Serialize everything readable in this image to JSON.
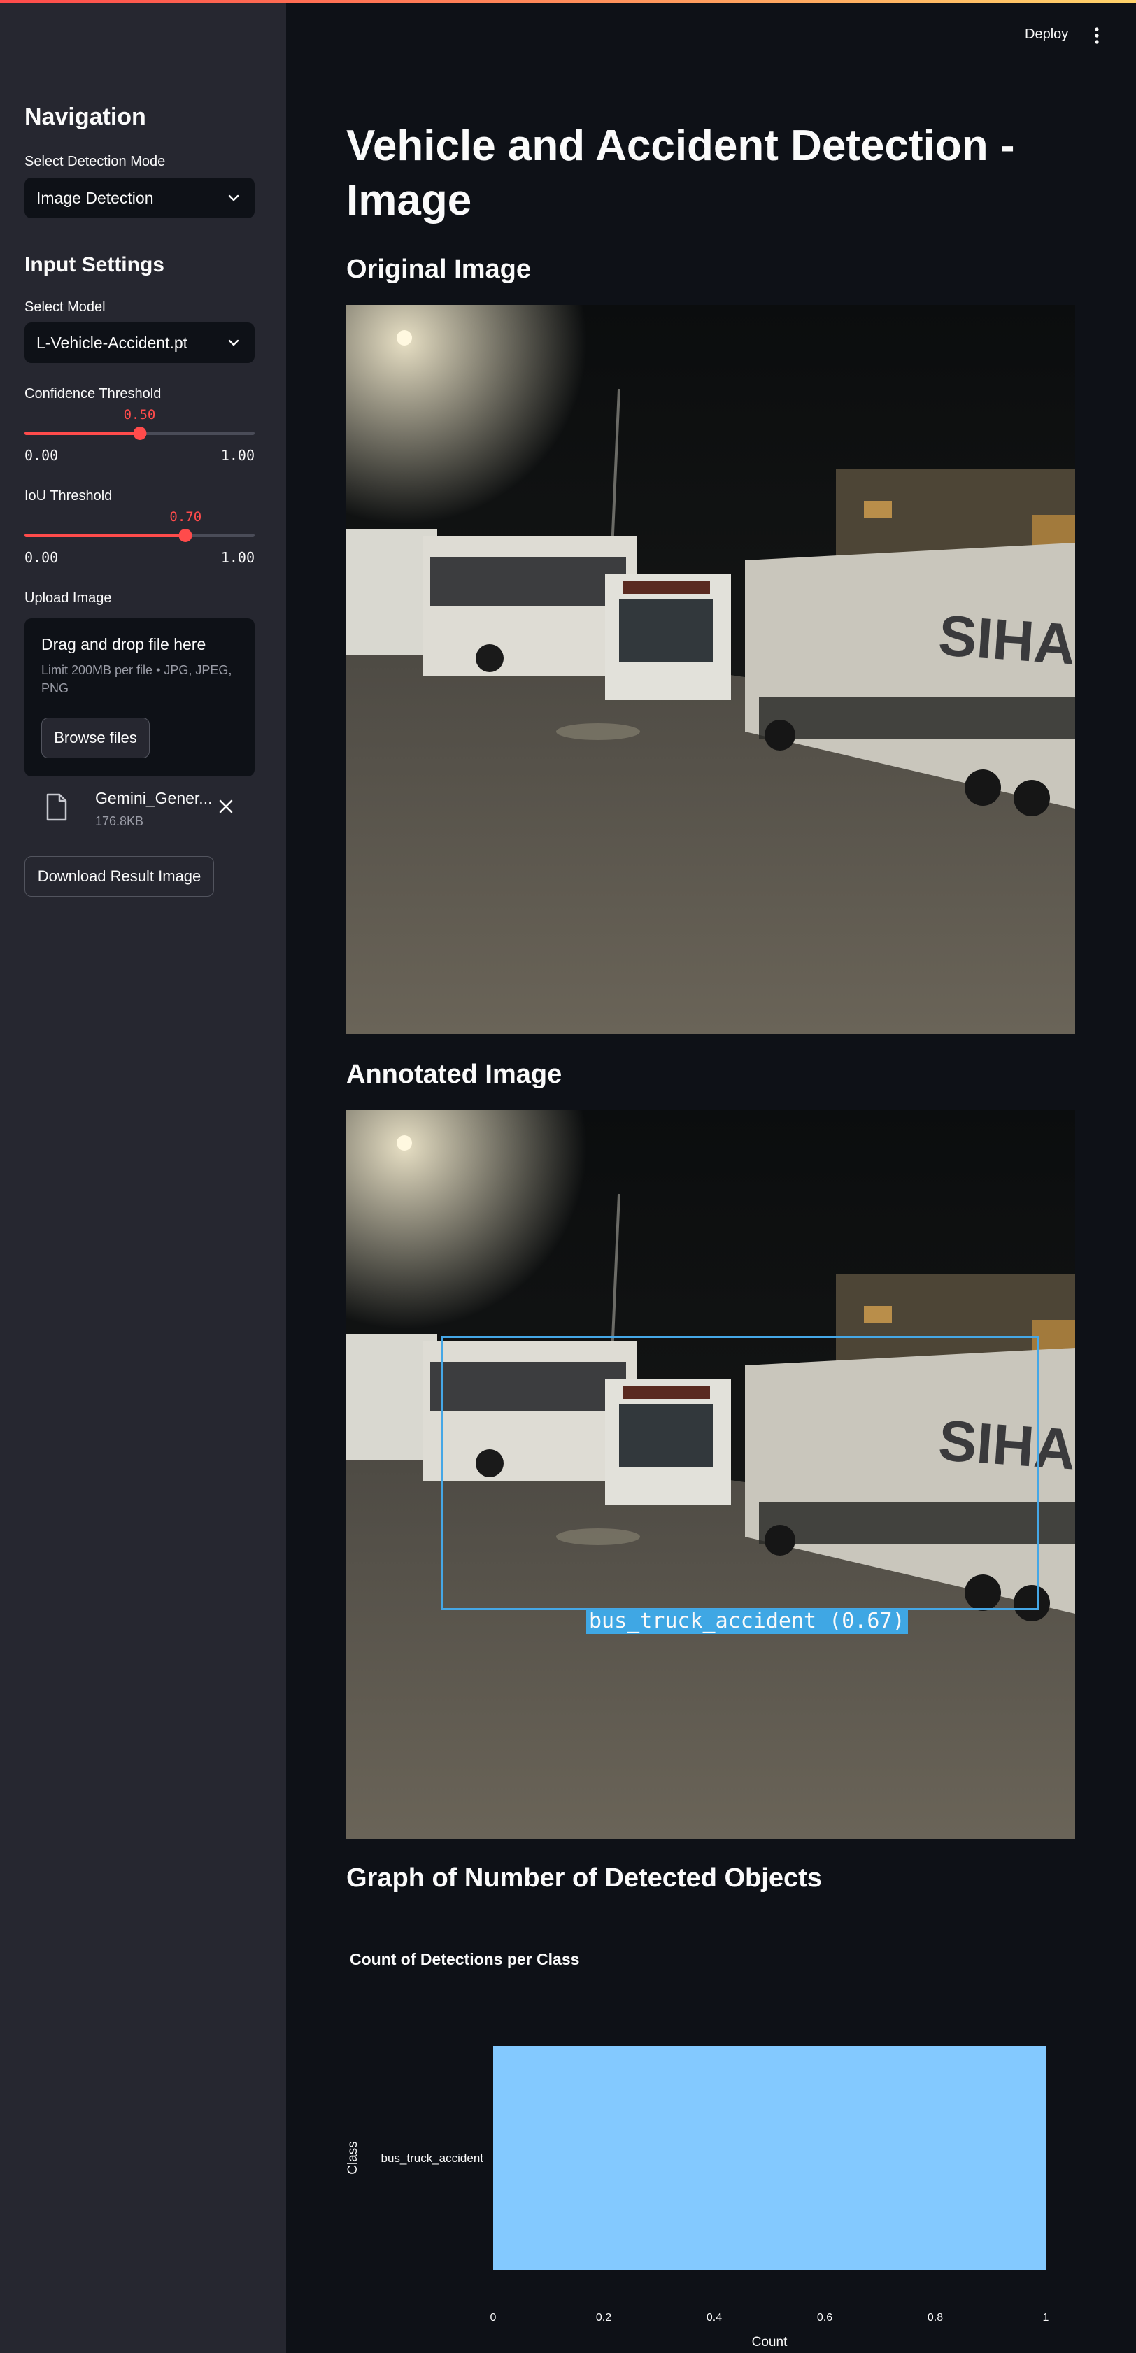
{
  "header": {
    "deploy_label": "Deploy",
    "menu_icon": "vertical-dots-icon"
  },
  "sidebar": {
    "nav_title": "Navigation",
    "mode_label": "Select Detection Mode",
    "mode_value": "Image Detection",
    "input_title": "Input Settings",
    "model_label": "Select Model",
    "model_value": "L-Vehicle-Accident.pt",
    "confidence": {
      "label": "Confidence Threshold",
      "value": 0.5,
      "value_text": "0.50",
      "min_text": "0.00",
      "max_text": "1.00"
    },
    "iou": {
      "label": "IoU Threshold",
      "value": 0.7,
      "value_text": "0.70",
      "min_text": "0.00",
      "max_text": "1.00"
    },
    "upload_label": "Upload Image",
    "dropzone_title": "Drag and drop file here",
    "dropzone_limit": "Limit 200MB per file • JPG, JPEG, PNG",
    "browse_label": "Browse files",
    "file_name": "Gemini_Gener...",
    "file_size": "176.8KB",
    "download_label": "Download Result Image",
    "accent_color": "#ff4b4b"
  },
  "main": {
    "title": "Vehicle and Accident Detection - Image",
    "original_heading": "Original Image",
    "annotated_heading": "Annotated Image",
    "detection_label": "bus_truck_accident (0.67)",
    "detection_color": "#3fa7e4",
    "truck_text": "SIHAM",
    "graph_heading": "Graph of Number of Detected Objects"
  },
  "chart_data": {
    "type": "bar",
    "orientation": "horizontal",
    "title": "Count of Detections per Class",
    "xlabel": "Count",
    "ylabel": "Class",
    "categories": [
      "bus_truck_accident"
    ],
    "values": [
      1
    ],
    "xlim": [
      0,
      1
    ],
    "xticks": [
      "0",
      "0.2",
      "0.4",
      "0.6",
      "0.8",
      "1"
    ],
    "bar_color": "#83c9ff",
    "grid": false
  }
}
